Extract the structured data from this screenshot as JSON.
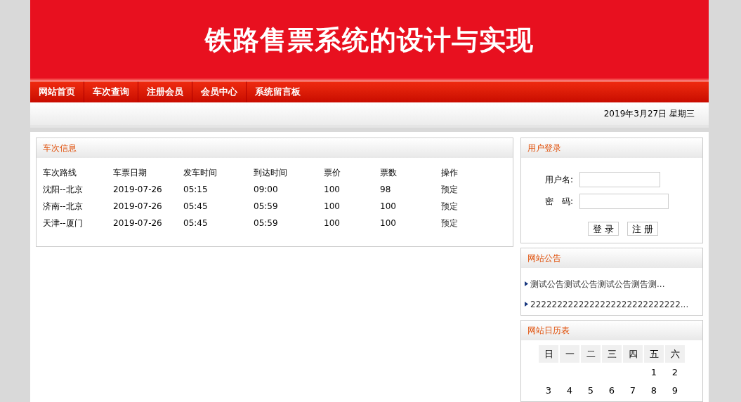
{
  "header": {
    "title": "铁路售票系统的设计与实现"
  },
  "nav": [
    {
      "label": "网站首页"
    },
    {
      "label": "车次查询"
    },
    {
      "label": "注册会员"
    },
    {
      "label": "会员中心"
    },
    {
      "label": "系统留言板"
    }
  ],
  "date": "2019年3月27日 星期三",
  "trains": {
    "title": "车次信息",
    "columns": [
      "车次路线",
      "车票日期",
      "发车时间",
      "到达时间",
      "票价",
      "票数",
      "操作"
    ],
    "rows": [
      [
        "沈阳--北京",
        "2019-07-26",
        "05:15",
        "09:00",
        "100",
        "98",
        "预定"
      ],
      [
        "济南--北京",
        "2019-07-26",
        "05:45",
        "05:59",
        "100",
        "100",
        "预定"
      ],
      [
        "天津--厦门",
        "2019-07-26",
        "05:45",
        "05:59",
        "100",
        "100",
        "预定"
      ]
    ]
  },
  "login": {
    "title": "用户登录",
    "username_label": "用户名:",
    "password_label": "密　码:",
    "buttons": [
      "登 录",
      "注 册"
    ]
  },
  "notices": {
    "title": "网站公告",
    "items": [
      "测试公告测试公告测试公告测告测...",
      "2222222222222222222222222222..."
    ]
  },
  "calendar": {
    "title": "网站日历表",
    "weekdays": [
      "日",
      "一",
      "二",
      "三",
      "四",
      "五",
      "六"
    ],
    "weeks": [
      [
        "1",
        "2"
      ],
      [
        "3",
        "4",
        "5",
        "6",
        "7",
        "8",
        "9"
      ]
    ]
  }
}
